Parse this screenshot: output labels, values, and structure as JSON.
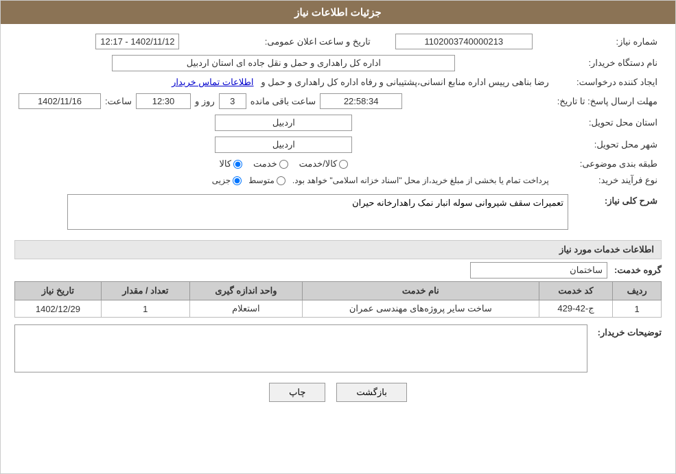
{
  "header": {
    "title": "جزئیات اطلاعات نیاز"
  },
  "fields": {
    "need_number_label": "شماره نیاز:",
    "need_number_value": "1102003740000213",
    "announce_date_label": "تاریخ و ساعت اعلان عمومی:",
    "announce_date_value": "1402/11/12 - 12:17",
    "buyer_org_label": "نام دستگاه خریدار:",
    "buyer_org_value": "اداره کل راهداری و حمل و نقل جاده ای استان اردبیل",
    "creator_label": "ایجاد کننده درخواست:",
    "creator_value": "رضا بناهی رییس اداره منابع انسانی،پشتیبانی و رفاه اداره کل راهداری و حمل و",
    "creator_link": "اطلاعات تماس خریدار",
    "deadline_label": "مهلت ارسال پاسخ: تا تاریخ:",
    "deadline_date": "1402/11/16",
    "deadline_time_label": "ساعت:",
    "deadline_time": "12:30",
    "deadline_days_label": "روز و",
    "deadline_days": "3",
    "deadline_remaining_label": "ساعت باقی مانده",
    "deadline_remaining": "22:58:34",
    "province_label": "استان محل تحویل:",
    "province_value": "اردبیل",
    "city_label": "شهر محل تحویل:",
    "city_value": "اردبیل",
    "category_label": "طبقه بندی موضوعی:",
    "category_options": [
      "کالا",
      "خدمت",
      "کالا/خدمت"
    ],
    "category_selected": "کالا",
    "process_label": "نوع فرآیند خرید:",
    "process_options": [
      "جزیی",
      "متوسط"
    ],
    "process_note": "پرداخت تمام یا بخشی از مبلغ خرید،از محل \"اسناد خزانه اسلامی\" خواهد بود.",
    "description_label": "شرح کلی نیاز:",
    "description_value": "تعمیرات سقف شیروانی سوله انبار نمک راهدارخانه حیران"
  },
  "services_section": {
    "title": "اطلاعات خدمات مورد نیاز",
    "group_label": "گروه خدمت:",
    "group_value": "ساختمان",
    "table_headers": [
      "ردیف",
      "کد خدمت",
      "نام خدمت",
      "واحد اندازه گیری",
      "تعداد / مقدار",
      "تاریخ نیاز"
    ],
    "table_rows": [
      {
        "row_num": "1",
        "service_code": "ج-42-429",
        "service_name": "ساخت سایر پروژه‌های مهندسی عمران",
        "unit": "استعلام",
        "quantity": "1",
        "date": "1402/12/29"
      }
    ]
  },
  "buyer_desc": {
    "label": "توضیحات خریدار:",
    "value": ""
  },
  "buttons": {
    "print": "چاپ",
    "back": "بازگشت"
  }
}
